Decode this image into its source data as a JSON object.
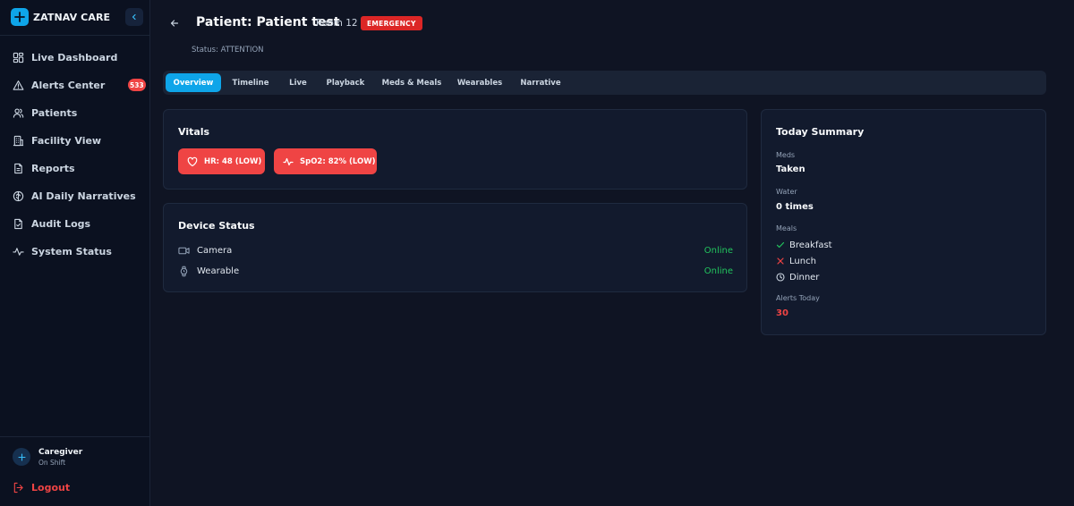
{
  "brand": {
    "name": "ZATNAV CARE"
  },
  "sidebar": {
    "items": [
      {
        "label": "Live Dashboard",
        "icon": "dashboard-icon"
      },
      {
        "label": "Alerts Center",
        "icon": "alert-triangle-icon",
        "badge": "533"
      },
      {
        "label": "Patients",
        "icon": "users-icon"
      },
      {
        "label": "Facility View",
        "icon": "building-icon"
      },
      {
        "label": "Reports",
        "icon": "file-text-icon"
      },
      {
        "label": "AI Daily Narratives",
        "icon": "brain-icon"
      },
      {
        "label": "Audit Logs",
        "icon": "file-check-icon"
      },
      {
        "label": "System Status",
        "icon": "activity-icon"
      }
    ]
  },
  "user": {
    "name": "Caregiver",
    "status": "On Shift"
  },
  "logout_label": "Logout",
  "header": {
    "title": "Patient: Patient test",
    "room": "Room 12",
    "badge": "EMERGENCY",
    "status": "Status: ATTENTION"
  },
  "tabs": [
    {
      "label": "Overview",
      "active": true
    },
    {
      "label": "Timeline"
    },
    {
      "label": "Live"
    },
    {
      "label": "Playback"
    },
    {
      "label": "Meds & Meals"
    },
    {
      "label": "Wearables"
    },
    {
      "label": "Narrative"
    }
  ],
  "vitals": {
    "title": "Vitals",
    "items": [
      {
        "label": "HR: 48 (LOW)",
        "icon": "heart-icon"
      },
      {
        "label": "SpO2: 82% (LOW)",
        "icon": "pulse-icon"
      }
    ]
  },
  "devices": {
    "title": "Device Status",
    "items": [
      {
        "name": "Camera",
        "status": "Online",
        "icon": "camera-icon"
      },
      {
        "name": "Wearable",
        "status": "Online",
        "icon": "watch-icon"
      }
    ]
  },
  "summary": {
    "title": "Today Summary",
    "meds_label": "Meds",
    "meds_value": "Taken",
    "water_label": "Water",
    "water_value": "0 times",
    "meals_label": "Meals",
    "meals": [
      {
        "name": "Breakfast",
        "state": "done",
        "icon": "check-icon"
      },
      {
        "name": "Lunch",
        "state": "missed",
        "icon": "x-icon"
      },
      {
        "name": "Dinner",
        "state": "pending",
        "icon": "clock-icon"
      }
    ],
    "alerts_label": "Alerts Today",
    "alerts_value": "30"
  },
  "colors": {
    "accent": "#0ea5e9",
    "danger": "#ef4444",
    "success": "#22c55e",
    "background": "#0f1423"
  }
}
